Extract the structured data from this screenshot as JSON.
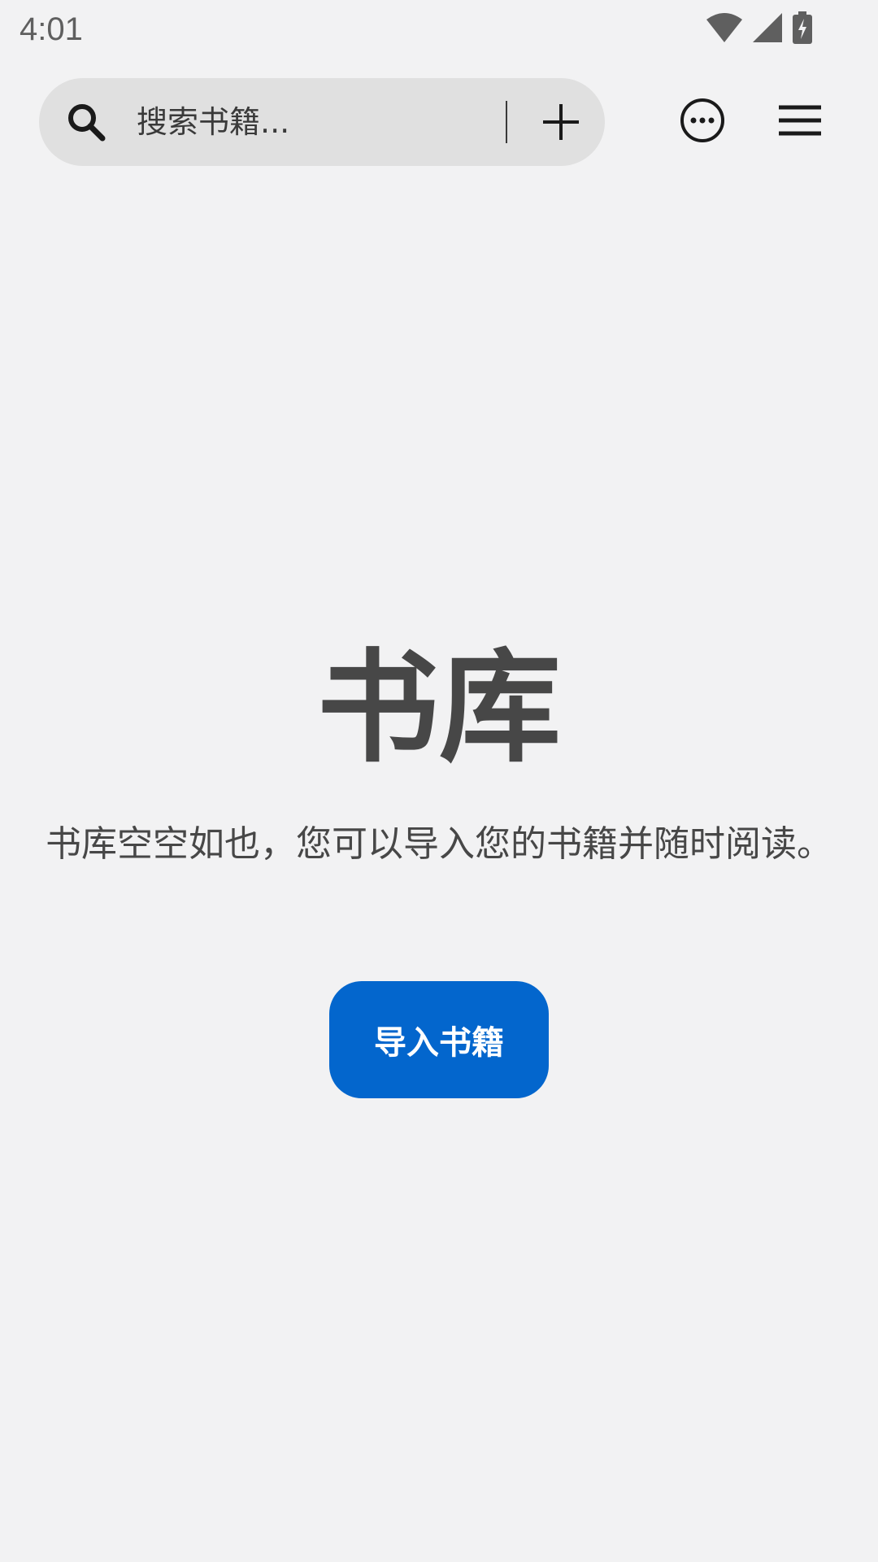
{
  "status_bar": {
    "time": "4:01",
    "icons": [
      "wifi-icon",
      "signal-icon",
      "battery-charging-icon"
    ]
  },
  "toolbar": {
    "search_placeholder": "搜索书籍...",
    "icons": {
      "search": "search-icon",
      "add": "plus-icon",
      "more": "more-horizontal-icon",
      "menu": "hamburger-menu-icon"
    }
  },
  "library": {
    "title": "书库",
    "empty_message": "书库空空如也，您可以导入您的书籍并随时阅读。",
    "import_button_label": "导入书籍"
  },
  "colors": {
    "background": "#f2f2f3",
    "search_background": "#e0e0e0",
    "accent": "#0366cd",
    "text": "#474747"
  }
}
